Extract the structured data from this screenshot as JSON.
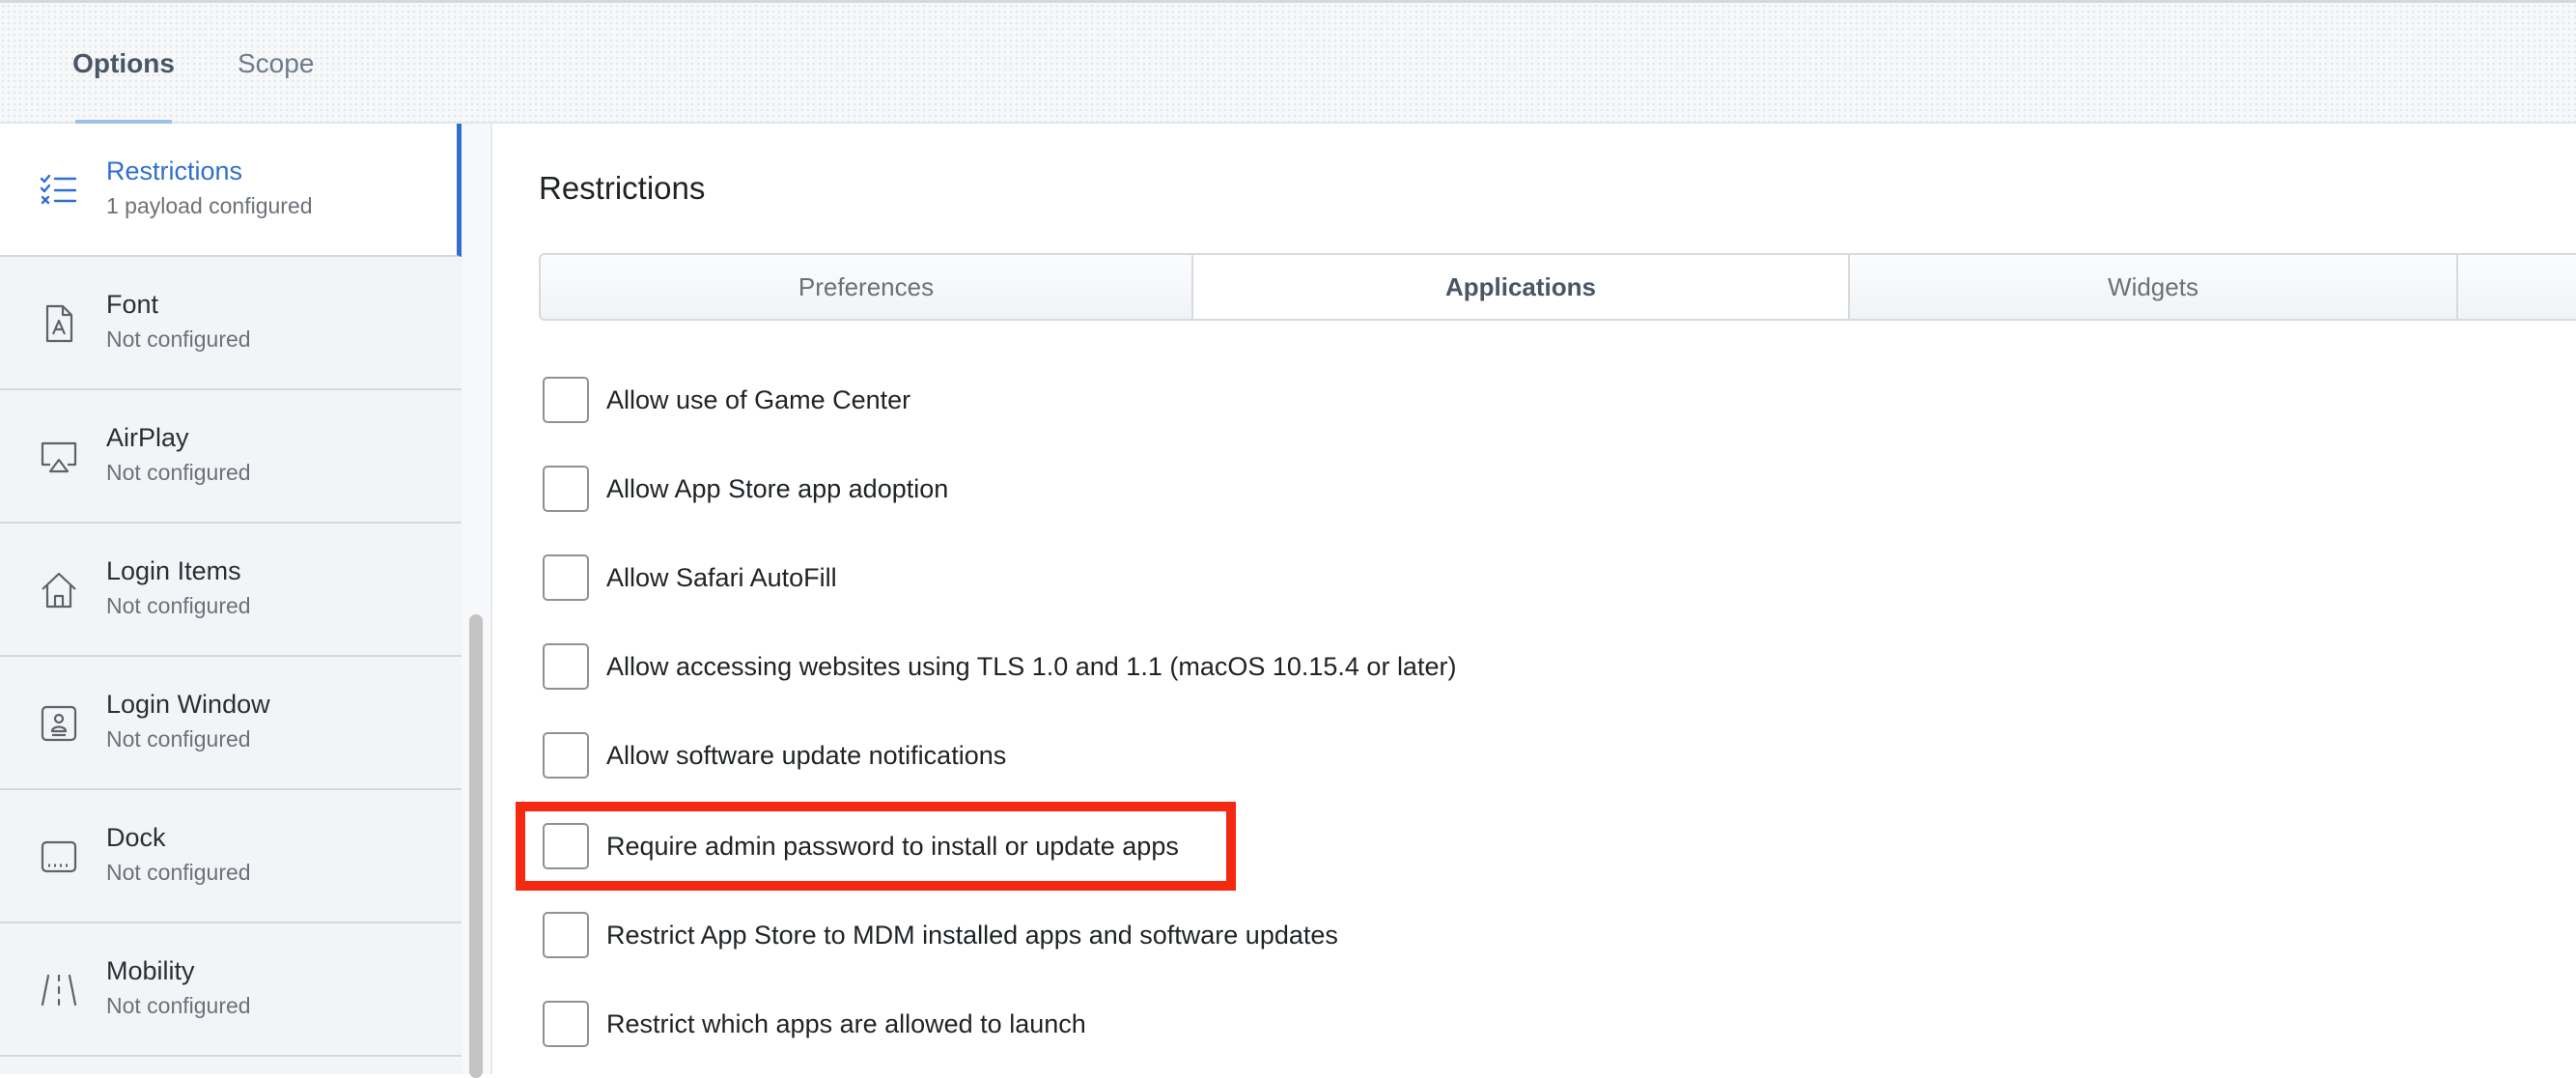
{
  "top_tabs": [
    {
      "label": "Options",
      "active": true
    },
    {
      "label": "Scope",
      "active": false
    }
  ],
  "sidebar": {
    "items": [
      {
        "title": "Restrictions",
        "subtitle": "1 payload configured",
        "icon": "restrictions-checklist-icon",
        "active": true
      },
      {
        "title": "Font",
        "subtitle": "Not configured",
        "icon": "font-file-icon",
        "active": false
      },
      {
        "title": "AirPlay",
        "subtitle": "Not configured",
        "icon": "airplay-icon",
        "active": false
      },
      {
        "title": "Login Items",
        "subtitle": "Not configured",
        "icon": "home-icon",
        "active": false
      },
      {
        "title": "Login Window",
        "subtitle": "Not configured",
        "icon": "login-window-icon",
        "active": false
      },
      {
        "title": "Dock",
        "subtitle": "Not configured",
        "icon": "dock-icon",
        "active": false
      },
      {
        "title": "Mobility",
        "subtitle": "Not configured",
        "icon": "mobility-road-icon",
        "active": false
      }
    ]
  },
  "main": {
    "title": "Restrictions",
    "segments": [
      {
        "label": "Preferences",
        "active": false
      },
      {
        "label": "Applications",
        "active": true
      },
      {
        "label": "Widgets",
        "active": false
      },
      {
        "label": "",
        "active": false
      }
    ],
    "options": [
      {
        "label": "Allow use of Game Center",
        "checked": false
      },
      {
        "label": "Allow App Store app adoption",
        "checked": false
      },
      {
        "label": "Allow Safari AutoFill",
        "checked": false
      },
      {
        "label": "Allow accessing websites using TLS 1.0 and 1.1 (macOS 10.15.4 or later)",
        "checked": false
      },
      {
        "label": "Allow software update notifications",
        "checked": false
      },
      {
        "label": "Require admin password to install or update apps",
        "checked": false,
        "highlighted": true
      },
      {
        "label": "Restrict App Store to MDM installed apps and software updates",
        "checked": false
      },
      {
        "label": "Restrict which apps are allowed to launch",
        "checked": false
      }
    ]
  },
  "colors": {
    "accent": "#2f6fcf",
    "highlight": "#f5290f",
    "tab_underline": "#9ec2e6"
  }
}
